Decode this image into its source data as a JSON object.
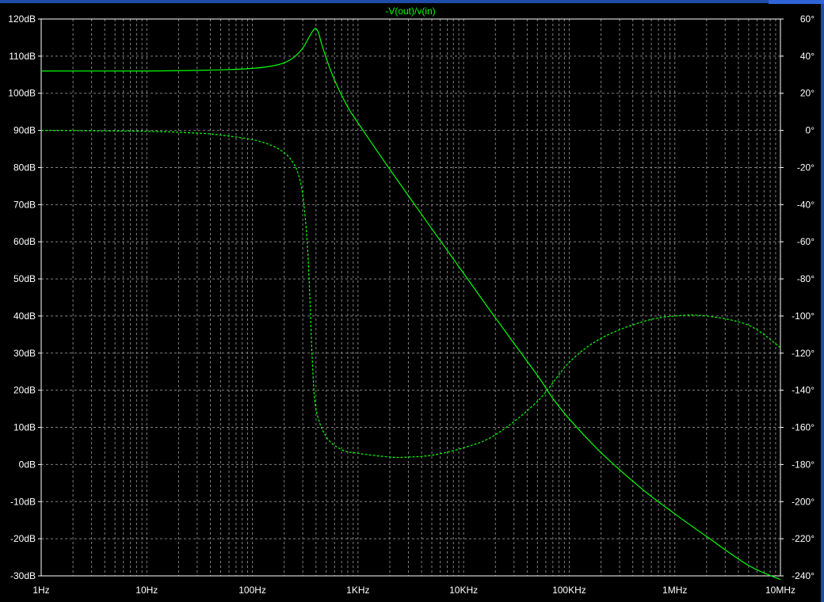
{
  "window": {
    "accent_color": "#1e4ca8"
  },
  "chart_data": {
    "type": "line",
    "title": "-V(out)/v(in)",
    "xlabel": "",
    "ylabel": "",
    "x_scale": "log",
    "xlim": [
      1,
      10000000
    ],
    "ylim_left": [
      -30,
      120
    ],
    "ylim_right": [
      -240,
      60
    ],
    "grid": true,
    "background": "#000000",
    "grid_color": "#808080",
    "trace_color": "#00ff00",
    "x_ticks": [
      {
        "value": 1,
        "label": "1Hz"
      },
      {
        "value": 10,
        "label": "10Hz"
      },
      {
        "value": 100,
        "label": "100Hz"
      },
      {
        "value": 1000,
        "label": "1KHz"
      },
      {
        "value": 10000,
        "label": "10KHz"
      },
      {
        "value": 100000,
        "label": "100KHz"
      },
      {
        "value": 1000000,
        "label": "1MHz"
      },
      {
        "value": 10000000,
        "label": "10MHz"
      }
    ],
    "y_left_ticks": [
      {
        "value": 120,
        "label": "120dB"
      },
      {
        "value": 110,
        "label": "110dB"
      },
      {
        "value": 100,
        "label": "100dB"
      },
      {
        "value": 90,
        "label": "90dB"
      },
      {
        "value": 80,
        "label": "80dB"
      },
      {
        "value": 70,
        "label": "70dB"
      },
      {
        "value": 60,
        "label": "60dB"
      },
      {
        "value": 50,
        "label": "50dB"
      },
      {
        "value": 40,
        "label": "40dB"
      },
      {
        "value": 30,
        "label": "30dB"
      },
      {
        "value": 20,
        "label": "20dB"
      },
      {
        "value": 10,
        "label": "10dB"
      },
      {
        "value": 0,
        "label": "0dB"
      },
      {
        "value": -10,
        "label": "-10dB"
      },
      {
        "value": -20,
        "label": "-20dB"
      },
      {
        "value": -30,
        "label": "-30dB"
      }
    ],
    "y_right_ticks": [
      {
        "value": 60,
        "label": "60°"
      },
      {
        "value": 40,
        "label": "40°"
      },
      {
        "value": 20,
        "label": "20°"
      },
      {
        "value": 0,
        "label": "0°"
      },
      {
        "value": -20,
        "label": "-20°"
      },
      {
        "value": -40,
        "label": "-40°"
      },
      {
        "value": -60,
        "label": "-60°"
      },
      {
        "value": -80,
        "label": "-80°"
      },
      {
        "value": -100,
        "label": "-100°"
      },
      {
        "value": -120,
        "label": "-120°"
      },
      {
        "value": -140,
        "label": "-140°"
      },
      {
        "value": -160,
        "label": "-160°"
      },
      {
        "value": -180,
        "label": "-180°"
      },
      {
        "value": -200,
        "label": "-200°"
      },
      {
        "value": -220,
        "label": "-220°"
      },
      {
        "value": -240,
        "label": "-240°"
      }
    ],
    "series": [
      {
        "axis": "left",
        "style": "solid",
        "x": [
          1,
          10,
          50,
          100,
          150,
          200,
          250,
          300,
          350,
          390,
          420,
          450,
          500,
          600,
          800,
          1000,
          2000,
          5000,
          10000,
          20000,
          50000,
          70000,
          100000,
          200000,
          500000,
          1000000,
          2000000,
          5000000,
          10000000
        ],
        "y": [
          106,
          106,
          106.3,
          106.7,
          107.3,
          108.2,
          109.8,
          112.2,
          115.5,
          117.4,
          116.5,
          113.5,
          109.5,
          103.5,
          96.3,
          92.0,
          79.5,
          63.5,
          51.5,
          39.5,
          24.0,
          17.8,
          12.3,
          3.2,
          -6.8,
          -13.3,
          -19.4,
          -27.2,
          -31.0
        ]
      },
      {
        "axis": "right",
        "style": "dashed",
        "x": [
          1,
          10,
          30,
          50,
          100,
          150,
          200,
          240,
          270,
          300,
          330,
          350,
          370,
          400,
          500,
          700,
          1000,
          2000,
          3000,
          5000,
          10000,
          20000,
          50000,
          100000,
          200000,
          500000,
          1000000,
          2000000,
          5000000,
          10000000
        ],
        "y": [
          0,
          -0.5,
          -1.5,
          -2.5,
          -5,
          -8,
          -12,
          -17,
          -23,
          -35,
          -60,
          -90,
          -125,
          -150,
          -165,
          -172,
          -174,
          -176,
          -176,
          -175,
          -171,
          -164,
          -146,
          -125,
          -112,
          -103,
          -100,
          -100,
          -105,
          -117
        ]
      }
    ]
  }
}
